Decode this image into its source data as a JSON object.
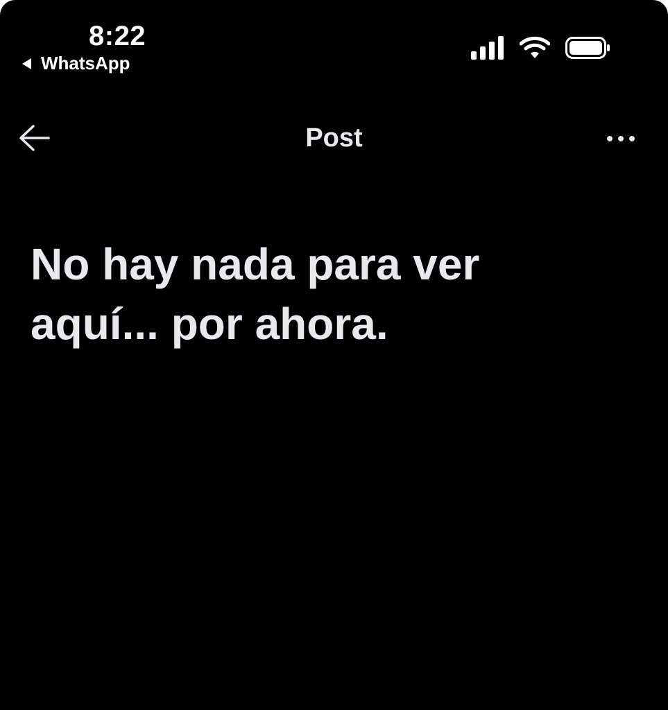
{
  "status_bar": {
    "time": "8:22",
    "back_app_label": "WhatsApp",
    "icons": [
      "signal-bars-icon",
      "wifi-icon",
      "battery-icon"
    ]
  },
  "nav": {
    "title": "Post",
    "back_icon": "arrow-left-icon",
    "more_icon": "more-horizontal-icon"
  },
  "main": {
    "empty_message": "No hay nada para ver aquí... por ahora."
  },
  "colors": {
    "background": "#000000",
    "text_primary": "#e7e9ea",
    "status_text": "#ffffff"
  }
}
